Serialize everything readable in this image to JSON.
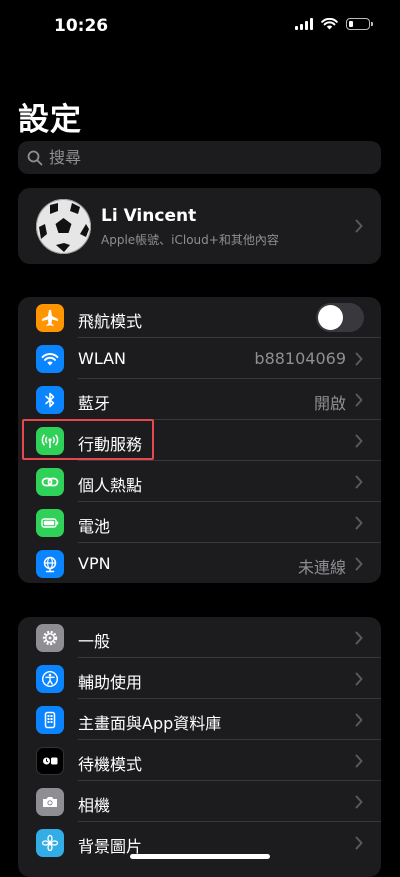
{
  "status_bar": {
    "time": "10:26"
  },
  "page": {
    "title": "設定"
  },
  "search": {
    "placeholder": "搜尋"
  },
  "profile": {
    "name": "Li Vincent",
    "subtitle": "Apple帳號、iCloud+和其他內容"
  },
  "connectivity": {
    "airplane_mode": {
      "label": "飛航模式",
      "icon": "airplane-icon",
      "color": "#ff9500",
      "toggle_on": false
    },
    "wlan": {
      "label": "WLAN",
      "value": "b88104069",
      "icon": "wifi-icon",
      "color": "#0a84ff"
    },
    "bluetooth": {
      "label": "藍牙",
      "value": "開啟",
      "icon": "bluetooth-icon",
      "color": "#0a84ff"
    },
    "cellular": {
      "label": "行動服務",
      "icon": "antenna-icon",
      "color": "#30d158"
    },
    "hotspot": {
      "label": "個人熱點",
      "icon": "link-icon",
      "color": "#30d158"
    },
    "battery": {
      "label": "電池",
      "icon": "battery-icon",
      "color": "#30d158"
    },
    "vpn": {
      "label": "VPN",
      "value": "未連線",
      "icon": "globe-icon",
      "color": "#0a84ff"
    }
  },
  "general_group": {
    "general": {
      "label": "一般",
      "icon": "gear-icon",
      "color": "#8e8e93"
    },
    "accessibility": {
      "label": "輔助使用",
      "icon": "accessibility-icon",
      "color": "#0a84ff"
    },
    "home_screen": {
      "label": "主畫面與App資料庫",
      "icon": "home-screen-icon",
      "color": "#0a84ff"
    },
    "standby": {
      "label": "待機模式",
      "icon": "standby-icon",
      "color": "#1c1c1e"
    },
    "camera": {
      "label": "相機",
      "icon": "camera-icon",
      "color": "#8e8e93"
    },
    "wallpaper": {
      "label": "背景圖片",
      "icon": "flower-icon",
      "color": "#32ade6"
    }
  },
  "colors": {
    "highlight": "#e5484d"
  }
}
